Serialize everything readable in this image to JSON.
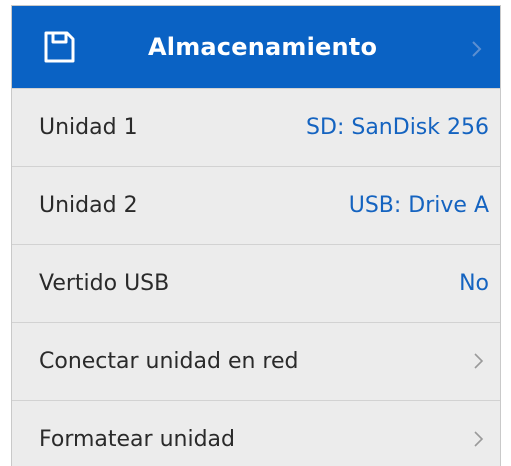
{
  "header": {
    "title": "Almacenamiento",
    "icon": "storage-card-icon",
    "background_color": "#0a62c4"
  },
  "rows": [
    {
      "label": "Unidad 1",
      "value": "SD: SanDisk 256"
    },
    {
      "label": "Unidad 2",
      "value": "USB: Drive A"
    },
    {
      "label": "Vertido USB",
      "value": "No"
    },
    {
      "label": "Conectar unidad en red",
      "icon": "chevron-right-icon"
    },
    {
      "label": "Formatear unidad",
      "icon": "chevron-right-icon"
    }
  ],
  "colors": {
    "value_text": "#1463c0",
    "panel_background": "#ececec"
  }
}
